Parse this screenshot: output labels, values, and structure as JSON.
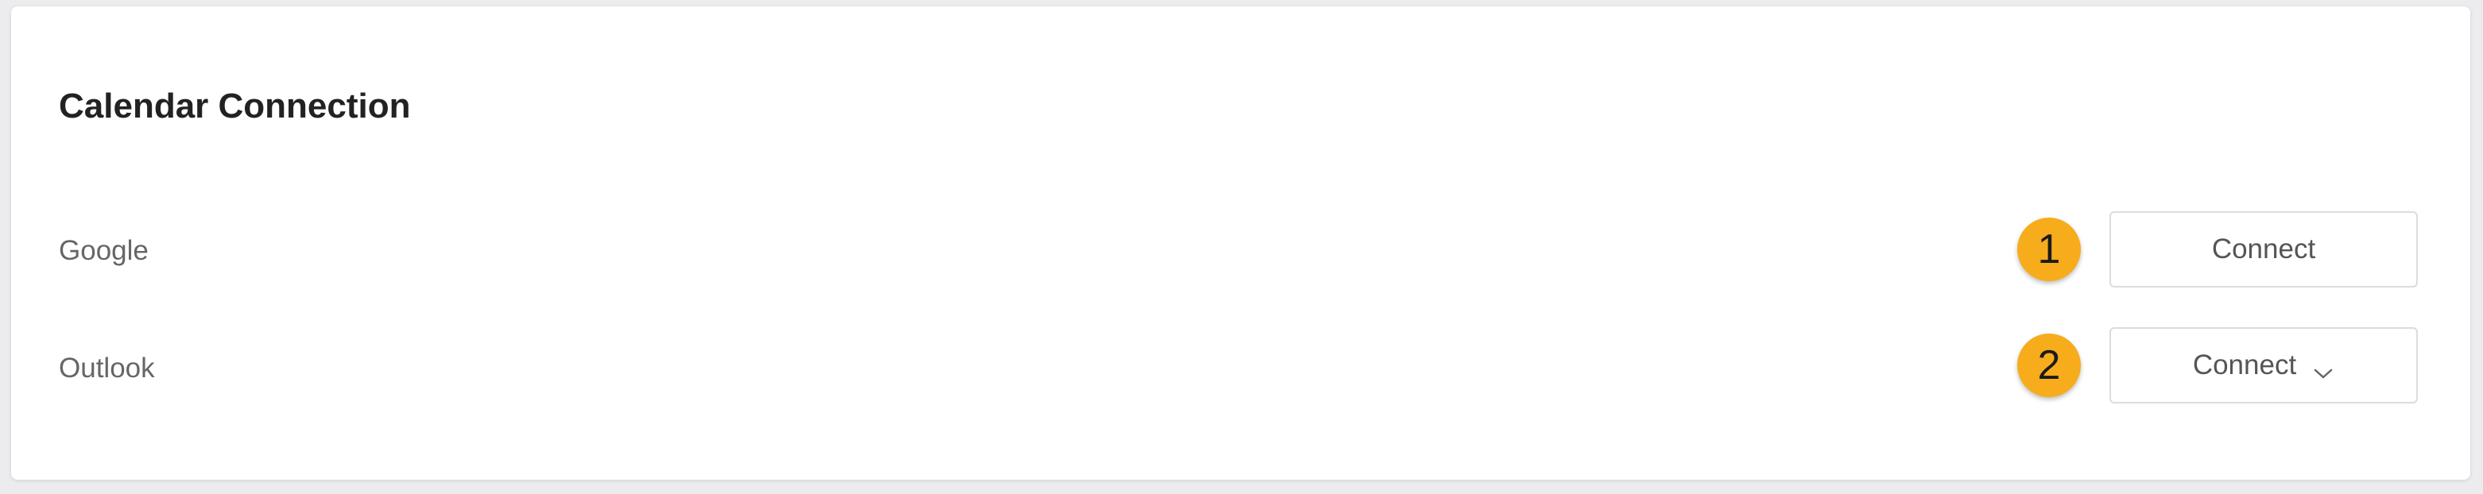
{
  "card": {
    "title": "Calendar Connection"
  },
  "rows": [
    {
      "label": "Google",
      "badge": "1",
      "button_label": "Connect",
      "has_dropdown": false
    },
    {
      "label": "Outlook",
      "badge": "2",
      "button_label": "Connect",
      "has_dropdown": true,
      "dropdown_icon": "chevron-down-icon"
    }
  ],
  "colors": {
    "badge": "#f7ac1c",
    "title": "#222222",
    "label": "#666666",
    "button_border": "#dcdcde"
  }
}
